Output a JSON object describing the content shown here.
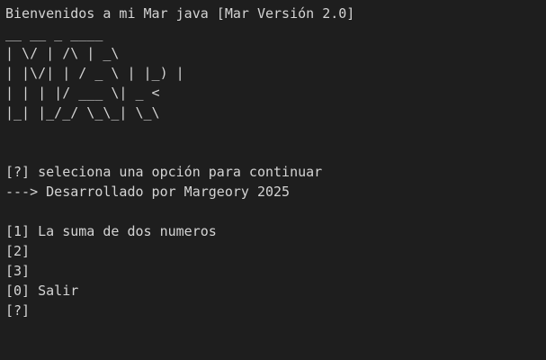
{
  "terminal": {
    "title_line": "Bienvenidos a mi Mar java [Mar Versión 2.0]",
    "banner": [
      "__ __ _ ____",
      "| \\/ | /\\ | _\\",
      "| |\\/| | / _ \\ | |_) |",
      "| | | |/ ___ \\| _ <",
      "|_| |_/_/ \\_\\_| \\_\\"
    ],
    "prompt_select": "[?] seleciona una opción para continuar",
    "credit": "---> Desarrollado por Margeory 2025",
    "options": [
      "[1] La suma de dos numeros",
      "[2]",
      "[3]",
      "[0] Salir"
    ],
    "input_prompt": "[?]"
  }
}
